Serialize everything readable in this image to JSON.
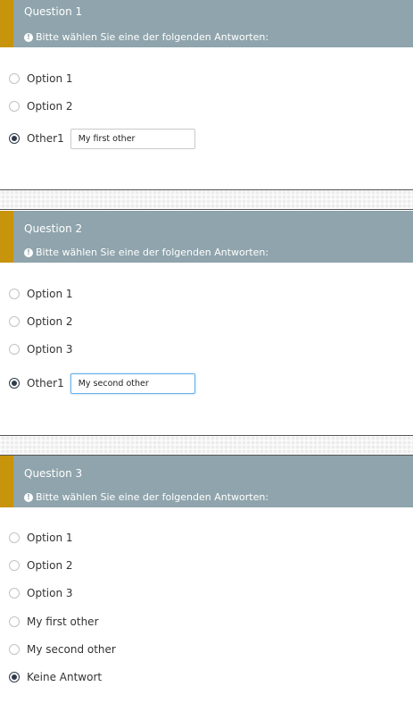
{
  "help_text": "Bitte wählen Sie eine der folgenden Antworten:",
  "questions": [
    {
      "title": "Question 1",
      "answers": [
        {
          "label": "Option 1",
          "checked": false
        },
        {
          "label": "Option 2",
          "checked": false
        },
        {
          "label": "Other1",
          "checked": true,
          "input_value": "My first other"
        }
      ]
    },
    {
      "title": "Question 2",
      "answers": [
        {
          "label": "Option 1",
          "checked": false
        },
        {
          "label": "Option 2",
          "checked": false
        },
        {
          "label": "Option 3",
          "checked": false
        },
        {
          "label": "Other1",
          "checked": true,
          "input_value": "My second other"
        }
      ]
    },
    {
      "title": "Question 3",
      "answers": [
        {
          "label": "Option 1",
          "checked": false
        },
        {
          "label": "Option 2",
          "checked": false
        },
        {
          "label": "Option 3",
          "checked": false
        },
        {
          "label": "My first other",
          "checked": false
        },
        {
          "label": "My second other",
          "checked": false
        },
        {
          "label": "Keine Antwort",
          "checked": true
        }
      ]
    }
  ],
  "colors": {
    "header_bg": "#8fa4ac",
    "accent": "#c8940c",
    "selected_radio": "#2f3b4a",
    "focus_border": "#66afe9"
  }
}
